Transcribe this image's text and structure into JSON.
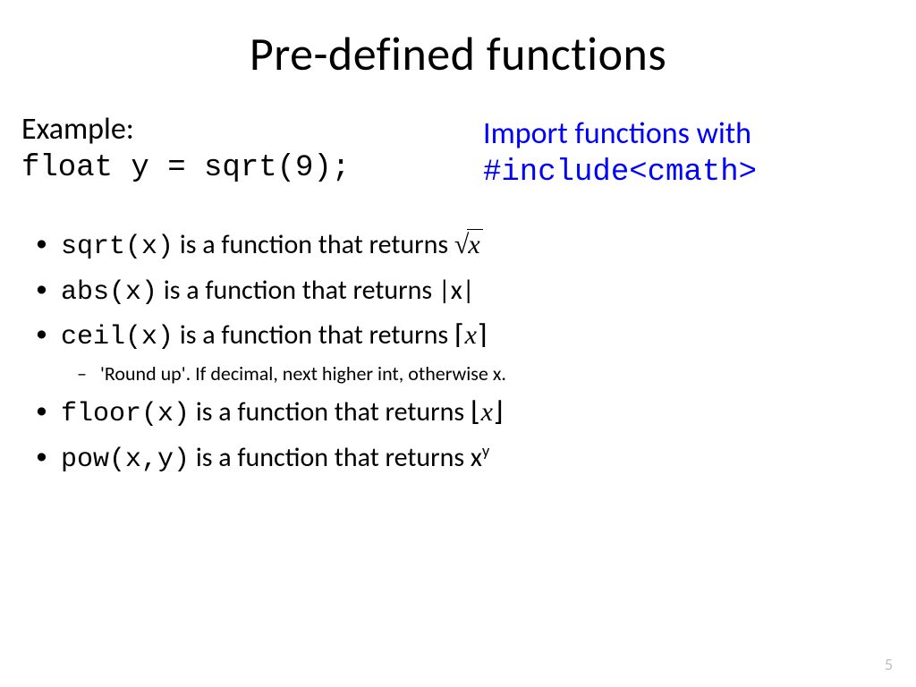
{
  "title": "Pre-defined functions",
  "example_label": "Example:",
  "example_code": "float y = sqrt(9);",
  "import_note": {
    "line1": "Import functions with",
    "line2": "#include<cmath>"
  },
  "items": {
    "sqrt": {
      "fn": "sqrt(x)",
      "mid": " is a function that returns ",
      "arg": "x"
    },
    "abs": {
      "fn": "abs(x)",
      "mid": " is a function that returns ",
      "result": "|x|"
    },
    "ceil": {
      "fn": "ceil(x)",
      "mid": " is a function that returns ",
      "arg": "x",
      "note": "'Round up'. If decimal, next higher int, otherwise x."
    },
    "floor": {
      "fn": "floor(x)",
      "mid": " is a function that returns ",
      "arg": "x"
    },
    "pow": {
      "fn": "pow(x,y)",
      "mid": " is a function that returns ",
      "base": "x",
      "exp": "y"
    }
  },
  "page_number": "5"
}
